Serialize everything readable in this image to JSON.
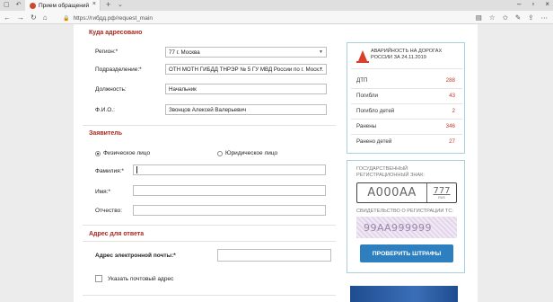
{
  "browser": {
    "tab_title": "Прием обращений",
    "url": "https://гибдд.рф/request_main"
  },
  "form": {
    "section_address": {
      "title": "Куда адресовано",
      "region_label": "Регион:*",
      "region_value": "77 г. Москва",
      "division_label": "Подразделение:*",
      "division_value": "ОТН МОТН ГИБДД ТНРЭР № 5 ГУ МВД России по г. Моск...",
      "position_label": "Должность:",
      "position_value": "Начальник",
      "fio_label": "Ф.И.О.:",
      "fio_value": "Звонцов Алексей Валерьевич"
    },
    "section_applicant": {
      "title": "Заявитель",
      "radio_physical": "Физическое лицо",
      "radio_legal": "Юридическое лицо",
      "surname_label": "Фамилия:*",
      "name_label": "Имя:*",
      "patronymic_label": "Отчество:"
    },
    "section_reply": {
      "title": "Адрес для ответа",
      "email_label": "Адрес электронной почты:*",
      "postal_checkbox_label": "Указать почтовый адрес"
    }
  },
  "stats": {
    "title": "АВАРИЙНОСТЬ НА ДОРОГАХ РОССИИ ЗА 24.11.2019",
    "rows": [
      {
        "label": "ДТП",
        "value": "288"
      },
      {
        "label": "Погибли",
        "value": "43"
      },
      {
        "label": "Погибло детей",
        "value": "2"
      },
      {
        "label": "Ранены",
        "value": "346"
      },
      {
        "label": "Ранено детей",
        "value": "27"
      }
    ]
  },
  "fines": {
    "plate_caption": "ГОСУДАРСТВЕННЫЙ РЕГИСТРАЦИОННЫЙ ЗНАК:",
    "plate_number": "А000АА",
    "plate_region": "777",
    "plate_country": "RUS",
    "cert_caption": "СВИДЕТЕЛЬСТВО О РЕГИСТРАЦИИ ТС:",
    "cert_number": "99АА999999",
    "check_button": "ПРОВЕРИТЬ ШТРАФЫ"
  }
}
